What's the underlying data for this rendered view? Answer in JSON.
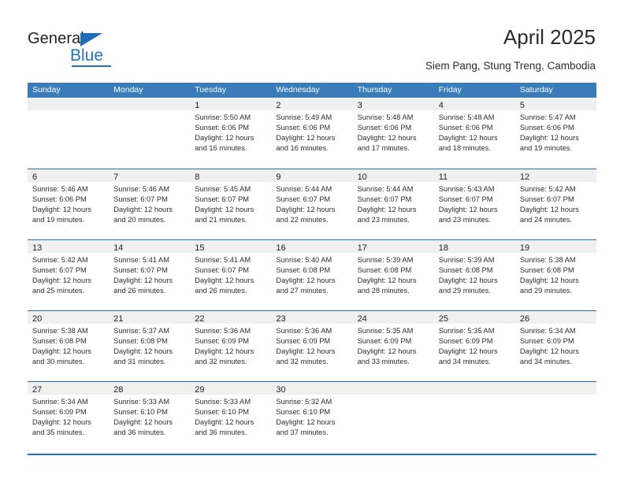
{
  "logo": {
    "word_top": "General",
    "word_bottom": "Blue",
    "triangle_icon": "triangle-icon",
    "brand_color": "#1f74bd"
  },
  "header": {
    "title": "April 2025",
    "subtitle": "Siem Pang, Stung Treng, Cambodia"
  },
  "calendar": {
    "header_bg": "#3a7cba",
    "rule_color": "#2c6ca8",
    "day_band_bg": "#f0f0f0",
    "weekdays": [
      "Sunday",
      "Monday",
      "Tuesday",
      "Wednesday",
      "Thursday",
      "Friday",
      "Saturday"
    ],
    "weeks": [
      [
        {
          "day": "",
          "lines": []
        },
        {
          "day": "",
          "lines": []
        },
        {
          "day": "1",
          "lines": [
            "Sunrise: 5:50 AM",
            "Sunset: 6:06 PM",
            "Daylight: 12 hours",
            "and 16 minutes."
          ]
        },
        {
          "day": "2",
          "lines": [
            "Sunrise: 5:49 AM",
            "Sunset: 6:06 PM",
            "Daylight: 12 hours",
            "and 16 minutes."
          ]
        },
        {
          "day": "3",
          "lines": [
            "Sunrise: 5:48 AM",
            "Sunset: 6:06 PM",
            "Daylight: 12 hours",
            "and 17 minutes."
          ]
        },
        {
          "day": "4",
          "lines": [
            "Sunrise: 5:48 AM",
            "Sunset: 6:06 PM",
            "Daylight: 12 hours",
            "and 18 minutes."
          ]
        },
        {
          "day": "5",
          "lines": [
            "Sunrise: 5:47 AM",
            "Sunset: 6:06 PM",
            "Daylight: 12 hours",
            "and 19 minutes."
          ]
        }
      ],
      [
        {
          "day": "6",
          "lines": [
            "Sunrise: 5:46 AM",
            "Sunset: 6:06 PM",
            "Daylight: 12 hours",
            "and 19 minutes."
          ]
        },
        {
          "day": "7",
          "lines": [
            "Sunrise: 5:46 AM",
            "Sunset: 6:07 PM",
            "Daylight: 12 hours",
            "and 20 minutes."
          ]
        },
        {
          "day": "8",
          "lines": [
            "Sunrise: 5:45 AM",
            "Sunset: 6:07 PM",
            "Daylight: 12 hours",
            "and 21 minutes."
          ]
        },
        {
          "day": "9",
          "lines": [
            "Sunrise: 5:44 AM",
            "Sunset: 6:07 PM",
            "Daylight: 12 hours",
            "and 22 minutes."
          ]
        },
        {
          "day": "10",
          "lines": [
            "Sunrise: 5:44 AM",
            "Sunset: 6:07 PM",
            "Daylight: 12 hours",
            "and 23 minutes."
          ]
        },
        {
          "day": "11",
          "lines": [
            "Sunrise: 5:43 AM",
            "Sunset: 6:07 PM",
            "Daylight: 12 hours",
            "and 23 minutes."
          ]
        },
        {
          "day": "12",
          "lines": [
            "Sunrise: 5:42 AM",
            "Sunset: 6:07 PM",
            "Daylight: 12 hours",
            "and 24 minutes."
          ]
        }
      ],
      [
        {
          "day": "13",
          "lines": [
            "Sunrise: 5:42 AM",
            "Sunset: 6:07 PM",
            "Daylight: 12 hours",
            "and 25 minutes."
          ]
        },
        {
          "day": "14",
          "lines": [
            "Sunrise: 5:41 AM",
            "Sunset: 6:07 PM",
            "Daylight: 12 hours",
            "and 26 minutes."
          ]
        },
        {
          "day": "15",
          "lines": [
            "Sunrise: 5:41 AM",
            "Sunset: 6:07 PM",
            "Daylight: 12 hours",
            "and 26 minutes."
          ]
        },
        {
          "day": "16",
          "lines": [
            "Sunrise: 5:40 AM",
            "Sunset: 6:08 PM",
            "Daylight: 12 hours",
            "and 27 minutes."
          ]
        },
        {
          "day": "17",
          "lines": [
            "Sunrise: 5:39 AM",
            "Sunset: 6:08 PM",
            "Daylight: 12 hours",
            "and 28 minutes."
          ]
        },
        {
          "day": "18",
          "lines": [
            "Sunrise: 5:39 AM",
            "Sunset: 6:08 PM",
            "Daylight: 12 hours",
            "and 29 minutes."
          ]
        },
        {
          "day": "19",
          "lines": [
            "Sunrise: 5:38 AM",
            "Sunset: 6:08 PM",
            "Daylight: 12 hours",
            "and 29 minutes."
          ]
        }
      ],
      [
        {
          "day": "20",
          "lines": [
            "Sunrise: 5:38 AM",
            "Sunset: 6:08 PM",
            "Daylight: 12 hours",
            "and 30 minutes."
          ]
        },
        {
          "day": "21",
          "lines": [
            "Sunrise: 5:37 AM",
            "Sunset: 6:08 PM",
            "Daylight: 12 hours",
            "and 31 minutes."
          ]
        },
        {
          "day": "22",
          "lines": [
            "Sunrise: 5:36 AM",
            "Sunset: 6:09 PM",
            "Daylight: 12 hours",
            "and 32 minutes."
          ]
        },
        {
          "day": "23",
          "lines": [
            "Sunrise: 5:36 AM",
            "Sunset: 6:09 PM",
            "Daylight: 12 hours",
            "and 32 minutes."
          ]
        },
        {
          "day": "24",
          "lines": [
            "Sunrise: 5:35 AM",
            "Sunset: 6:09 PM",
            "Daylight: 12 hours",
            "and 33 minutes."
          ]
        },
        {
          "day": "25",
          "lines": [
            "Sunrise: 5:35 AM",
            "Sunset: 6:09 PM",
            "Daylight: 12 hours",
            "and 34 minutes."
          ]
        },
        {
          "day": "26",
          "lines": [
            "Sunrise: 5:34 AM",
            "Sunset: 6:09 PM",
            "Daylight: 12 hours",
            "and 34 minutes."
          ]
        }
      ],
      [
        {
          "day": "27",
          "lines": [
            "Sunrise: 5:34 AM",
            "Sunset: 6:09 PM",
            "Daylight: 12 hours",
            "and 35 minutes."
          ]
        },
        {
          "day": "28",
          "lines": [
            "Sunrise: 5:33 AM",
            "Sunset: 6:10 PM",
            "Daylight: 12 hours",
            "and 36 minutes."
          ]
        },
        {
          "day": "29",
          "lines": [
            "Sunrise: 5:33 AM",
            "Sunset: 6:10 PM",
            "Daylight: 12 hours",
            "and 36 minutes."
          ]
        },
        {
          "day": "30",
          "lines": [
            "Sunrise: 5:32 AM",
            "Sunset: 6:10 PM",
            "Daylight: 12 hours",
            "and 37 minutes."
          ]
        },
        {
          "day": "",
          "lines": []
        },
        {
          "day": "",
          "lines": []
        },
        {
          "day": "",
          "lines": []
        }
      ]
    ]
  }
}
